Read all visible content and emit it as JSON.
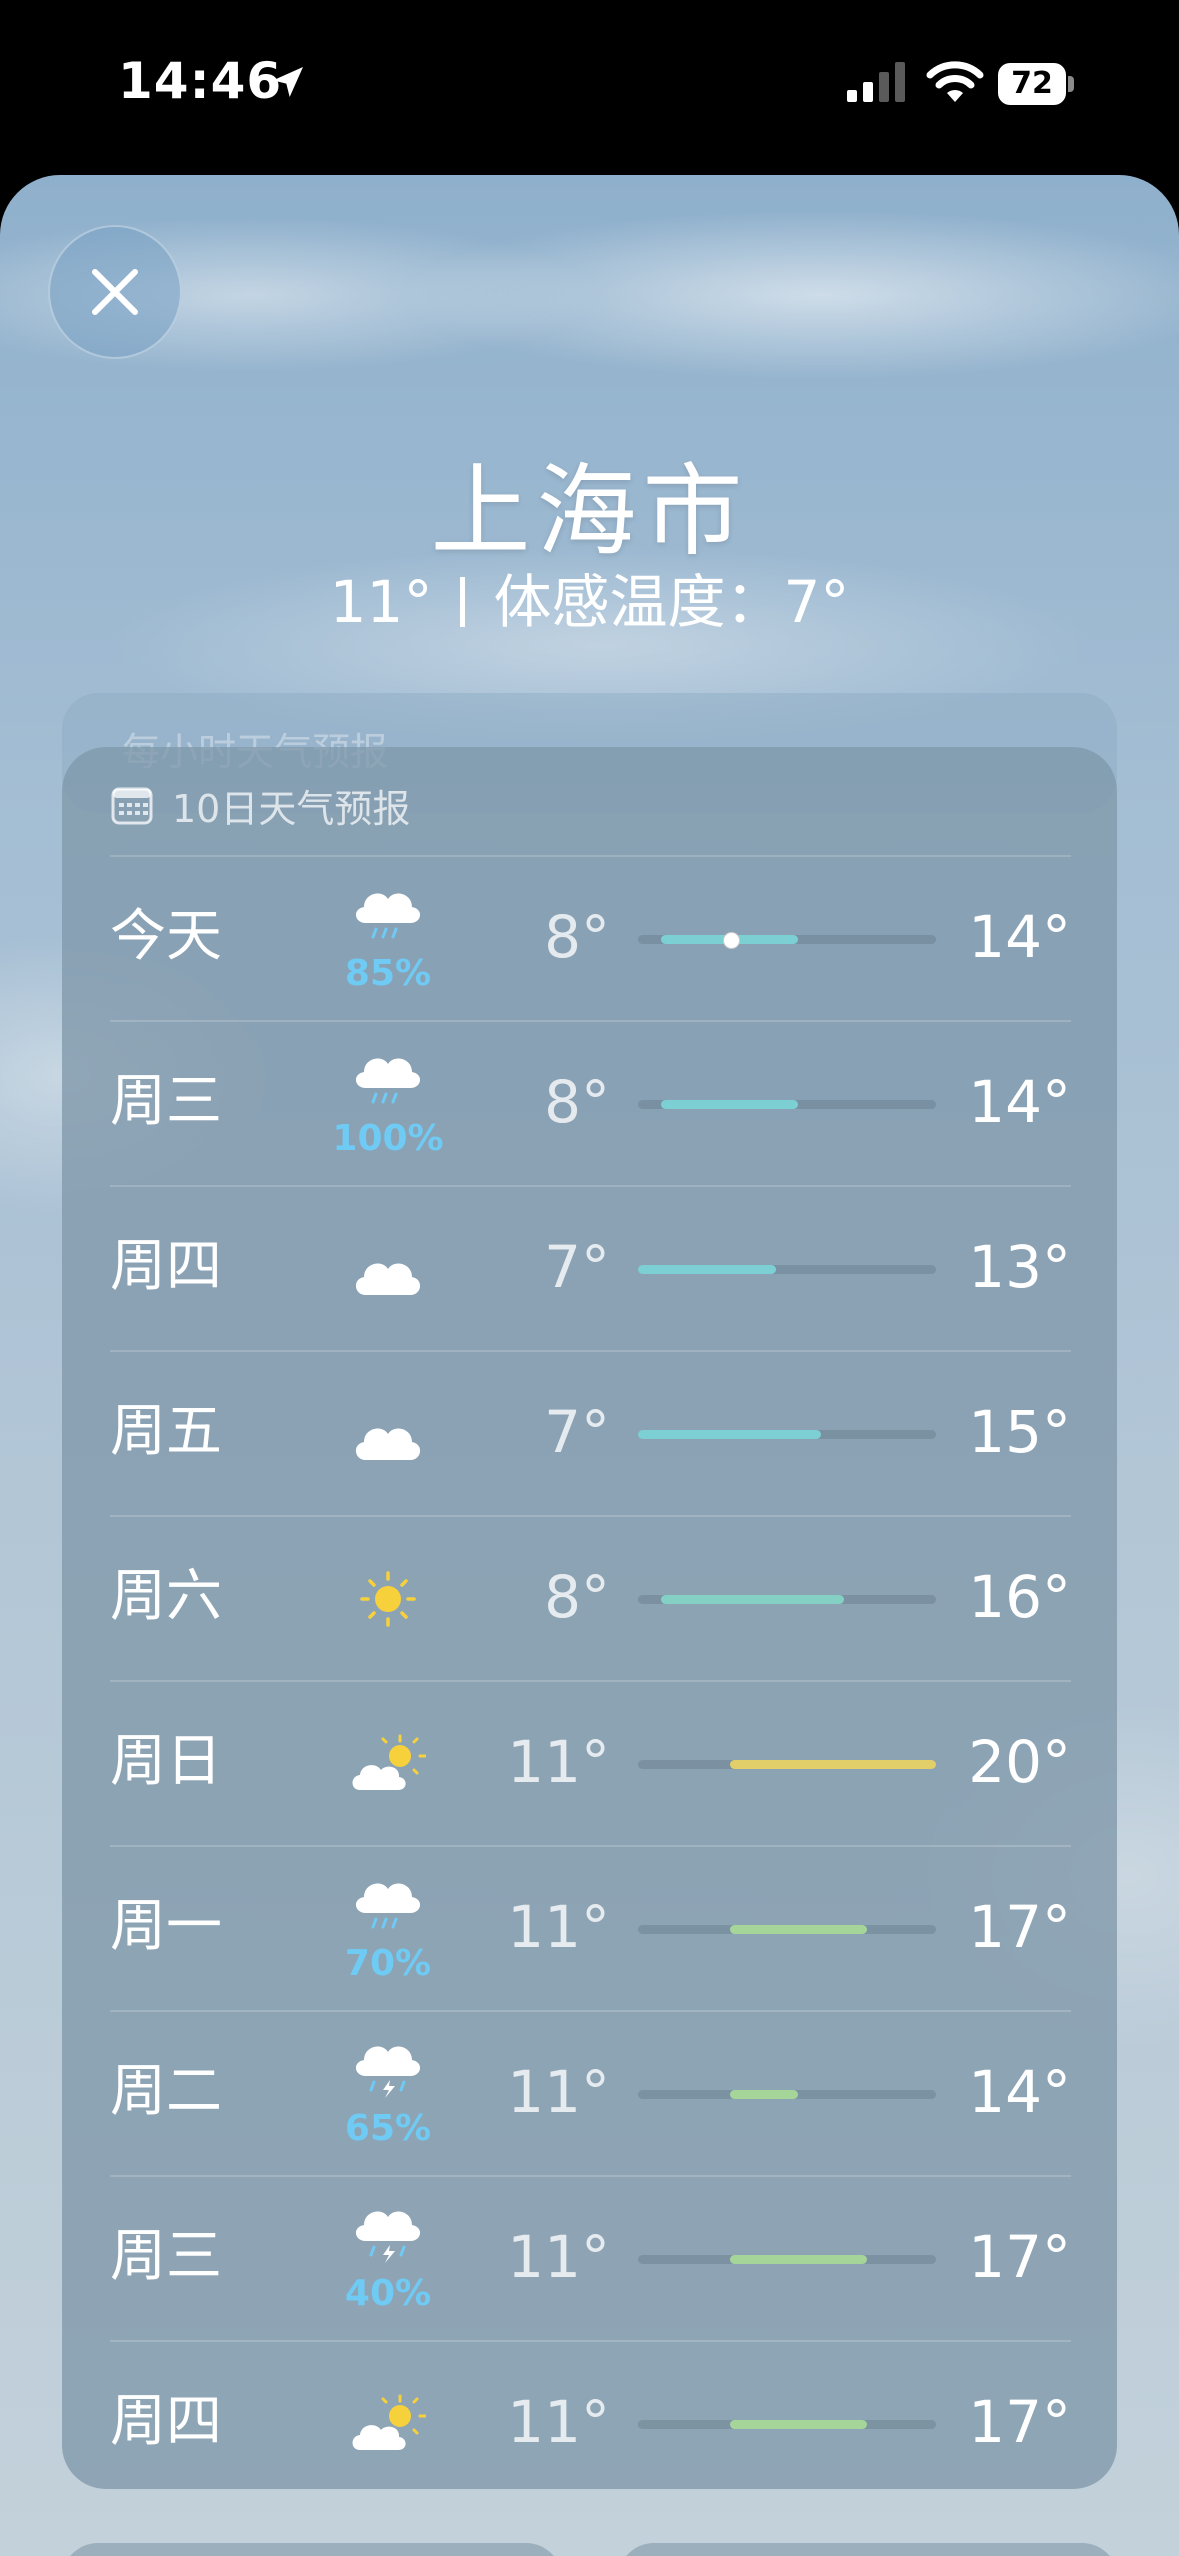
{
  "status_bar": {
    "time": "14:46",
    "battery": "72",
    "icons": [
      "location-arrow-icon",
      "cellular-signal-icon",
      "wifi-icon",
      "battery-icon"
    ]
  },
  "header": {
    "city": "上海市",
    "temperature": "11°",
    "feels_like": "体感温度：7°"
  },
  "behind_card_text": "每小时天气预报",
  "forecast": {
    "title": "10日天气预报",
    "range_min": 7,
    "range_max": 20,
    "current_temp": 11,
    "days": [
      {
        "day": "今天",
        "icon": "rain-cloud-icon",
        "precip": "85%",
        "low": "8°",
        "high": "14°",
        "low_value": 8,
        "high_value": 14,
        "color": "#7cd0d3"
      },
      {
        "day": "周三",
        "icon": "rain-cloud-icon",
        "precip": "100%",
        "low": "8°",
        "high": "14°",
        "low_value": 8,
        "high_value": 14,
        "color": "#7cd0d3"
      },
      {
        "day": "周四",
        "icon": "cloud-icon",
        "precip": "",
        "low": "7°",
        "high": "13°",
        "low_value": 7,
        "high_value": 13,
        "color": "#7cd0d3"
      },
      {
        "day": "周五",
        "icon": "cloud-icon",
        "precip": "",
        "low": "7°",
        "high": "15°",
        "low_value": 7,
        "high_value": 15,
        "color": "#7cd0d3"
      },
      {
        "day": "周六",
        "icon": "sun-icon",
        "precip": "",
        "low": "8°",
        "high": "16°",
        "low_value": 8,
        "high_value": 16,
        "color": "#85d0c4"
      },
      {
        "day": "周日",
        "icon": "partly-sunny-icon",
        "precip": "",
        "low": "11°",
        "high": "20°",
        "low_value": 11,
        "high_value": 20,
        "color": "#e3cf6a"
      },
      {
        "day": "周一",
        "icon": "rain-cloud-icon",
        "precip": "70%",
        "low": "11°",
        "high": "17°",
        "low_value": 11,
        "high_value": 17,
        "color": "#a6d59a"
      },
      {
        "day": "周二",
        "icon": "thunderstorm-icon",
        "precip": "65%",
        "low": "11°",
        "high": "14°",
        "low_value": 11,
        "high_value": 14,
        "color": "#a6d59a"
      },
      {
        "day": "周三",
        "icon": "thunderstorm-icon",
        "precip": "40%",
        "low": "11°",
        "high": "17°",
        "low_value": 11,
        "high_value": 17,
        "color": "#a6d59a"
      },
      {
        "day": "周四",
        "icon": "partly-sunny-icon",
        "precip": "",
        "low": "11°",
        "high": "17°",
        "low_value": 11,
        "high_value": 17,
        "color": "#a6d59a"
      }
    ]
  }
}
